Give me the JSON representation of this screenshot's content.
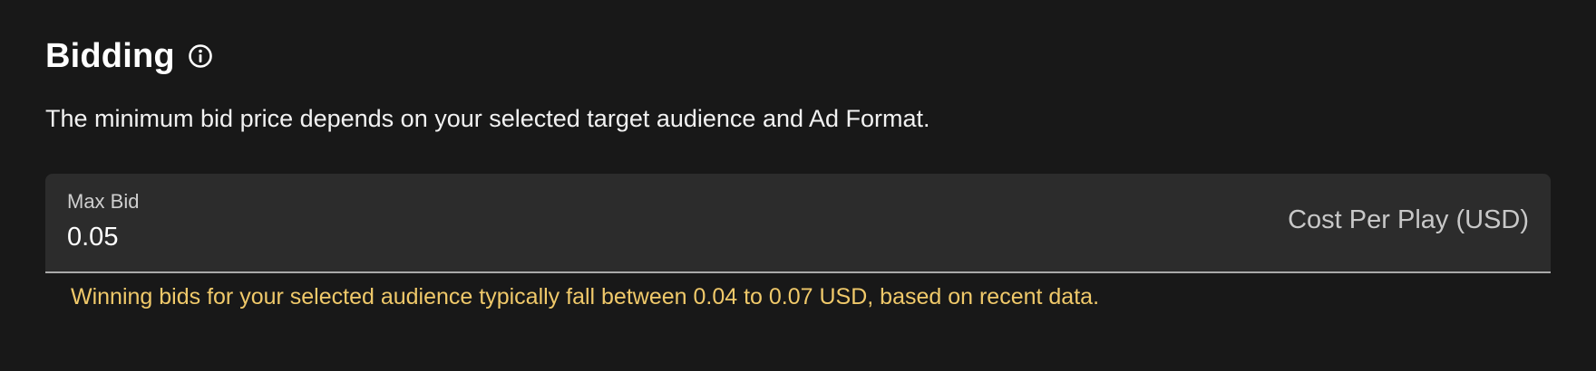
{
  "section": {
    "title": "Bidding",
    "info_icon": "info-circle-icon",
    "description": "The minimum bid price depends on your selected target audience and Ad Format."
  },
  "max_bid": {
    "label": "Max Bid",
    "value": "0.05",
    "suffix": "Cost Per Play (USD)",
    "helper_text": "Winning bids for your selected audience typically fall between 0.04 to 0.07 USD, based on recent data."
  },
  "colors": {
    "background": "#181818",
    "field_background": "#2c2c2c",
    "helper_text": "#f0c96a"
  }
}
